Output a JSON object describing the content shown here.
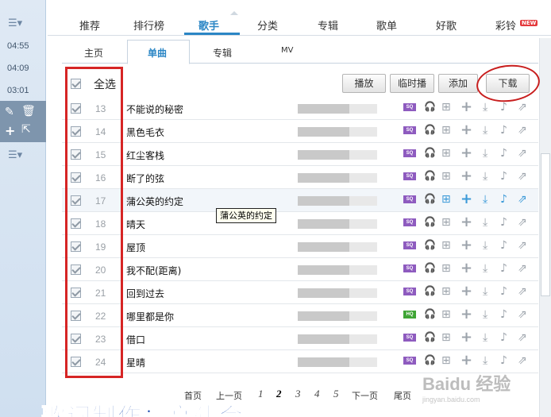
{
  "sidebar": {
    "times": [
      "04:55",
      "04:09",
      "03:01"
    ]
  },
  "nav": {
    "tabs": [
      "推荐",
      "排行榜",
      "歌手",
      "分类",
      "专辑",
      "歌单",
      "好歌",
      "彩铃"
    ],
    "new_badge": "NEW"
  },
  "subtabs": [
    "主页",
    "单曲",
    "专辑",
    "MV"
  ],
  "toolbar": {
    "select_all": "全选",
    "play": "播放",
    "temp_play": "临时播",
    "add": "添加",
    "download": "下载"
  },
  "songs": [
    {
      "num": "13",
      "title": "不能说的秘密",
      "quality": "SQ"
    },
    {
      "num": "14",
      "title": "黑色毛衣",
      "quality": "SQ"
    },
    {
      "num": "15",
      "title": "红尘客栈",
      "quality": "SQ"
    },
    {
      "num": "16",
      "title": "断了的弦",
      "quality": "SQ"
    },
    {
      "num": "17",
      "title": "蒲公英的约定",
      "quality": "SQ"
    },
    {
      "num": "18",
      "title": "晴天",
      "quality": "SQ"
    },
    {
      "num": "19",
      "title": "屋顶",
      "quality": "SQ"
    },
    {
      "num": "20",
      "title": "我不配(距离)",
      "quality": "SQ"
    },
    {
      "num": "21",
      "title": "回到过去",
      "quality": "SQ"
    },
    {
      "num": "22",
      "title": "哪里都是你",
      "quality": "HQ"
    },
    {
      "num": "23",
      "title": "借口",
      "quality": "SQ"
    },
    {
      "num": "24",
      "title": "星晴",
      "quality": "SQ"
    }
  ],
  "tooltip": "蒲公英的约定",
  "pager": {
    "first": "首页",
    "prev": "上一页",
    "pages": [
      "1",
      "2",
      "3",
      "4",
      "5"
    ],
    "current": "2",
    "next": "下一页",
    "last": "尾页"
  },
  "lyric_overlay": "歌词制作：高建会",
  "watermark": {
    "brand": "Baidu 经验",
    "url": "jingyan.baidu.com"
  },
  "colors": {
    "accent": "#2b86c5",
    "sq_badge": "#8e5bbf",
    "hq_badge": "#3fa535",
    "annotation": "#d62525"
  },
  "icons": [
    "headphones-icon",
    "add-to-list-icon",
    "plus-icon",
    "download-icon",
    "ringtone-icon",
    "share-icon"
  ]
}
